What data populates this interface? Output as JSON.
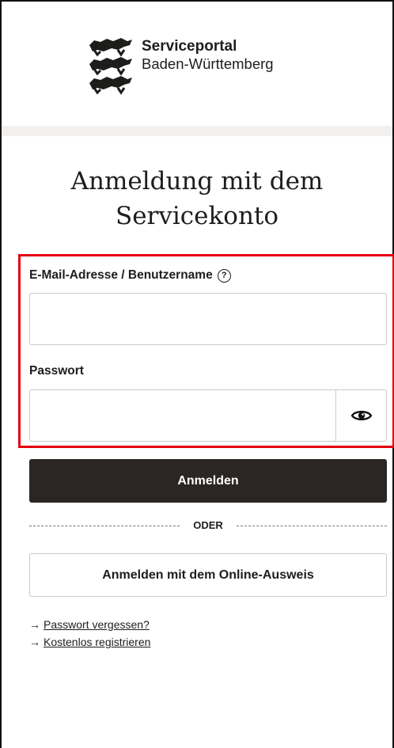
{
  "brand": {
    "name_line1": "Serviceportal",
    "name_line2": "Baden-Württemberg",
    "logo": "lions-coat-of-arms"
  },
  "page": {
    "title_line1": "Anmeldung mit dem",
    "title_line2": "Servicekonto"
  },
  "form": {
    "email_label": "E-Mail-Adresse / Benutzername",
    "email_value": "",
    "help_icon": "?",
    "password_label": "Passwort",
    "password_value": "",
    "show_password_icon": "eye-icon",
    "submit_label": "Anmelden"
  },
  "divider": {
    "label": "ODER"
  },
  "alt_login": {
    "label": "Anmelden mit dem Online-Ausweis"
  },
  "links": {
    "arrow": "→",
    "forgot_password": "Passwort vergessen?",
    "register": "Kostenlos registrieren"
  },
  "colors": {
    "primary_button": "#2b2624",
    "highlight_border": "#e4000f",
    "separator": "#f1f0ee"
  }
}
